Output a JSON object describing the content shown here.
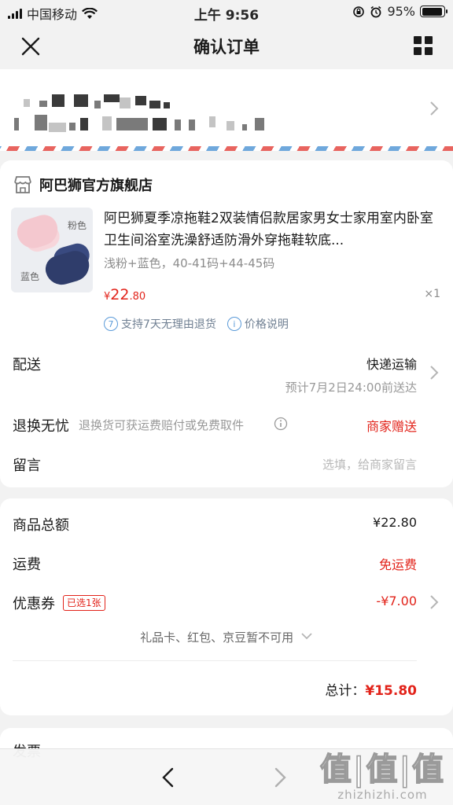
{
  "status_bar": {
    "carrier": "中国移动",
    "time": "上午 9:56",
    "battery": "95%",
    "battery_level": 0.95
  },
  "nav": {
    "title": "确认订单"
  },
  "address": {
    "blurred": true
  },
  "store": {
    "name": "阿巴狮官方旗舰店",
    "product": {
      "title": "阿巴狮夏季凉拖鞋2双装情侣款居家男女士家用室内卧室卫生间浴室洗澡舒适防滑外穿拖鞋软底...",
      "spec": "浅粉+蓝色，40-41码+44-45码",
      "price_symbol": "¥",
      "price_int": "22",
      "price_dec": ".80",
      "qty": "×1",
      "image_labels": {
        "pink": "粉色",
        "blue": "蓝色"
      }
    },
    "tags": [
      {
        "icon": "seven-days-icon",
        "icon_text": "7",
        "label": "支持7天无理由退货"
      },
      {
        "icon": "info-icon",
        "icon_text": "i",
        "label": "价格说明"
      }
    ],
    "delivery": {
      "label": "配送",
      "method": "快递运输",
      "eta": "预计7月2日24:00前送达"
    },
    "returns": {
      "label": "退换无忧",
      "desc": "退换货可获运费赔付或免费取件",
      "value": "商家赠送"
    },
    "message": {
      "label": "留言",
      "placeholder": "选填，给商家留言"
    }
  },
  "totals": {
    "goods": {
      "label": "商品总额",
      "value": "¥22.80"
    },
    "shipping": {
      "label": "运费",
      "value": "免运费"
    },
    "coupon": {
      "label": "优惠券",
      "badge": "已选1张",
      "value": "-¥7.00"
    },
    "gift_line": "礼品卡、红包、京豆暂不可用",
    "total_label": "总计：",
    "total_value": "¥15.80"
  },
  "invoice": {
    "label": "发票"
  },
  "watermark": {
    "logo": "值|值|值",
    "domain": "zhizhizhi.com"
  },
  "colors": {
    "accent_red": "#e2231a",
    "link_blue": "#5a9ad8",
    "background": "#f2f2f2"
  }
}
